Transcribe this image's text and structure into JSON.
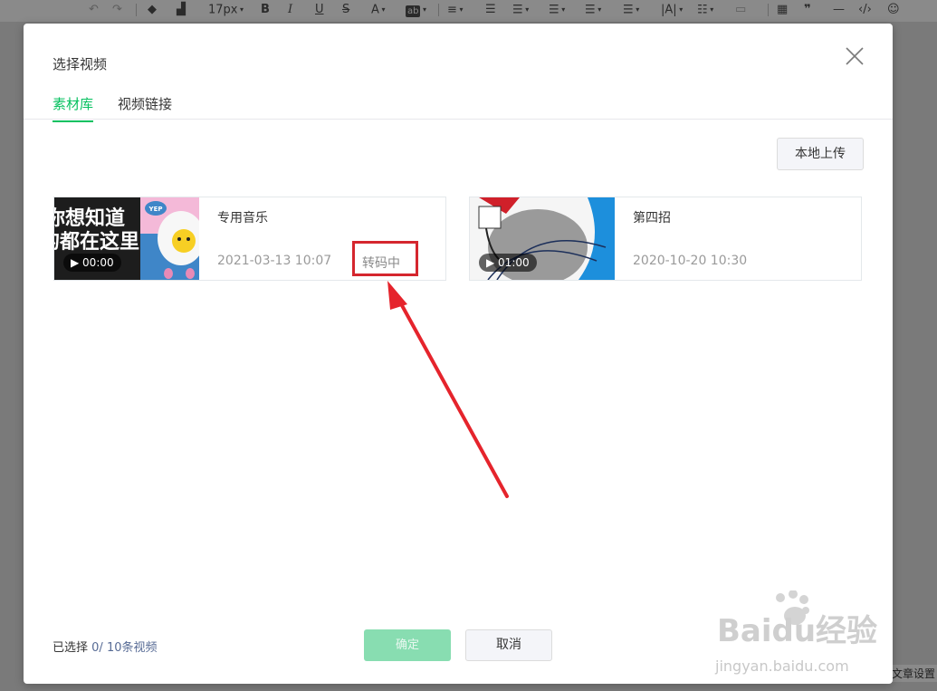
{
  "toolbar": {
    "font_size": "17px"
  },
  "dialog": {
    "title": "选择视频",
    "tabs": [
      {
        "label": "素材库",
        "active": true
      },
      {
        "label": "视频链接",
        "active": false
      }
    ],
    "upload_label": "本地上传",
    "videos": [
      {
        "name": "专用音乐",
        "date": "2021-03-13 10:07",
        "status": "转码中",
        "duration": "00:00",
        "thumb_text": [
          "你想知道",
          "的都在这里",
          "YEP"
        ]
      },
      {
        "name": "第四招",
        "date": "2020-10-20 10:30",
        "status": "",
        "duration": "01:00"
      }
    ],
    "footer": {
      "selected_label": "已选择",
      "selected_count": "0/ 10条视频",
      "confirm_label": "确定",
      "cancel_label": "取消"
    }
  },
  "background": {
    "hint": "文章设置"
  },
  "watermark": {
    "brand": "Baidu经验",
    "url": "jingyan.baidu.com"
  },
  "colors": {
    "accent": "#07c160",
    "annotation_red": "#d5262e",
    "confirm_disabled": "#88ddb1"
  }
}
